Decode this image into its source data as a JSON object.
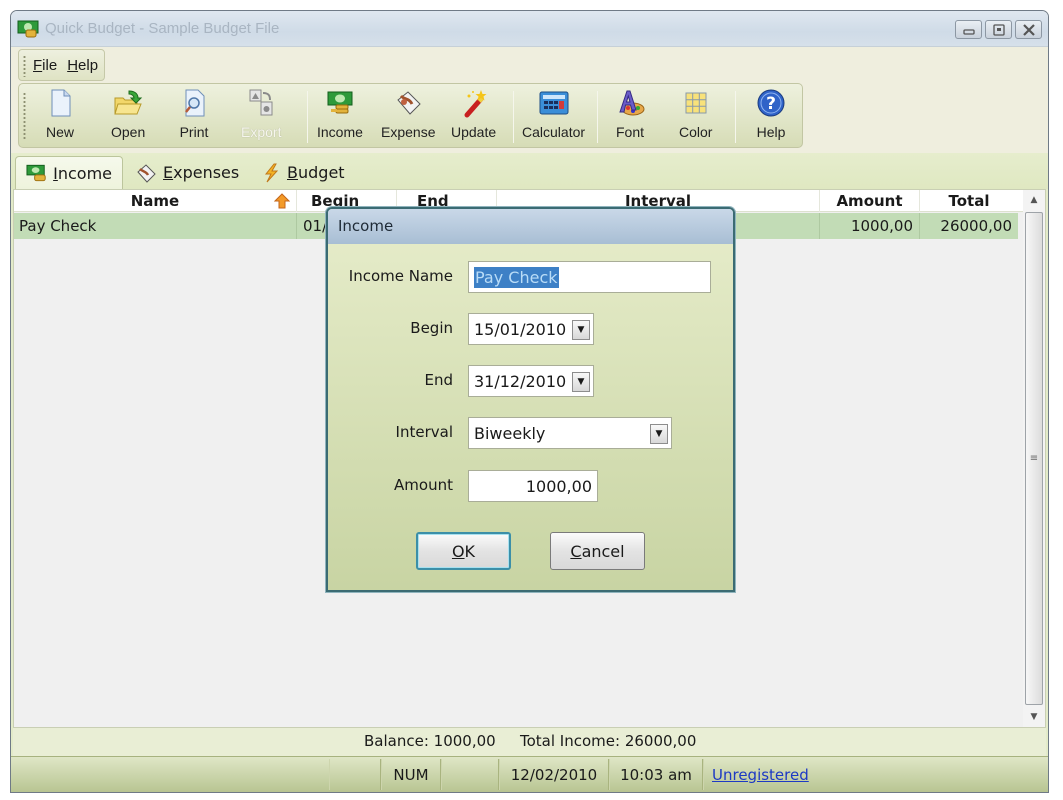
{
  "window": {
    "title": "Quick Budget - Sample Budget File",
    "controls": [
      "minimize",
      "maximize",
      "close"
    ]
  },
  "menubar": {
    "items": [
      {
        "label": "File",
        "mnemonic": "F",
        "rest": "ile"
      },
      {
        "label": "Help",
        "mnemonic": "H",
        "rest": "elp"
      }
    ]
  },
  "toolbar": {
    "buttons": [
      {
        "label": "New",
        "icon": "new-document-icon",
        "enabled": true
      },
      {
        "label": "Open",
        "icon": "open-folder-icon",
        "enabled": true
      },
      {
        "label": "Print",
        "icon": "print-preview-icon",
        "enabled": true
      },
      {
        "label": "Export",
        "icon": "export-icon",
        "enabled": false
      },
      {
        "label": "Income",
        "icon": "income-money-icon",
        "enabled": true
      },
      {
        "label": "Expense",
        "icon": "expense-icon",
        "enabled": true
      },
      {
        "label": "Update",
        "icon": "magic-wand-icon",
        "enabled": true
      },
      {
        "label": "Calculator",
        "icon": "calculator-icon",
        "enabled": true
      },
      {
        "label": "Font",
        "icon": "font-palette-icon",
        "enabled": true
      },
      {
        "label": "Color",
        "icon": "color-grid-icon",
        "enabled": true
      },
      {
        "label": "Help",
        "icon": "help-icon",
        "enabled": true
      }
    ]
  },
  "tabs": [
    {
      "label": "Income",
      "mnemonic": "I",
      "rest": "ncome",
      "active": true
    },
    {
      "label": "Expenses",
      "mnemonic": "E",
      "rest": "xpenses",
      "active": false
    },
    {
      "label": "Budget",
      "mnemonic": "B",
      "rest": "udget",
      "active": false
    }
  ],
  "grid": {
    "columns": [
      "Name",
      "Begin",
      "End",
      "Interval",
      "Amount",
      "Total"
    ],
    "sorted_column": "Name",
    "rows": [
      {
        "name": "Pay Check",
        "begin": "01/",
        "end": "",
        "interval": "",
        "amount": "1000,00",
        "total": "26000,00"
      }
    ]
  },
  "summary": {
    "balance": "Balance: 1000,00",
    "total_income": "Total Income: 26000,00"
  },
  "statusbar": {
    "num": "NUM",
    "date": "12/02/2010",
    "time": "10:03 am",
    "registration": "Unregistered"
  },
  "dialog": {
    "title": "Income",
    "fields": {
      "income_name": {
        "label": "Income Name",
        "value": "Pay Check"
      },
      "begin": {
        "label": "Begin",
        "value": "15/01/2010"
      },
      "end": {
        "label": "End",
        "value": "31/12/2010"
      },
      "interval": {
        "label": "Interval",
        "value": "Biweekly"
      },
      "amount": {
        "label": "Amount",
        "value": "1000,00"
      }
    },
    "ok": {
      "mnemonic": "O",
      "rest": "K"
    },
    "cancel": {
      "mnemonic": "C",
      "rest": "ancel"
    }
  },
  "colors": {
    "selected_row": "#c2dcb6",
    "selection_highlight": "#3d80c6",
    "link": "#1d39c4"
  }
}
